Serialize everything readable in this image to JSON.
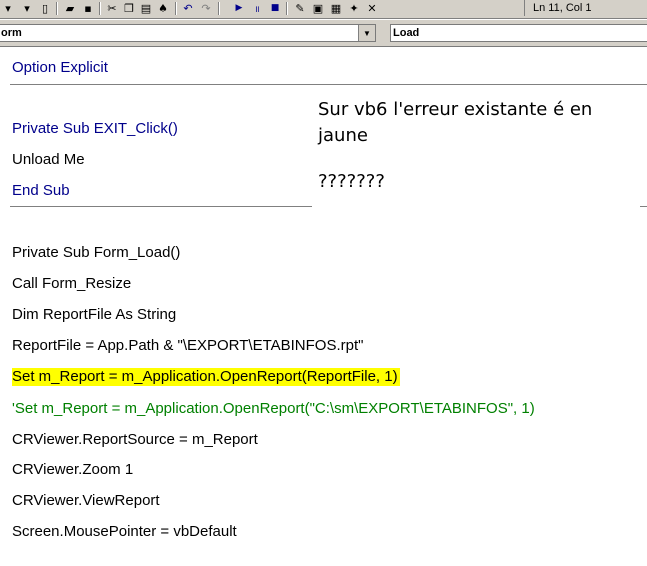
{
  "toolbar": {
    "status": "Ln 11, Col 1",
    "buttons": [
      {
        "name": "insert-dropdown-icon",
        "glyph": "▾"
      },
      {
        "name": "indent-dropdown-icon",
        "glyph": "▾"
      },
      {
        "name": "delete-icon",
        "glyph": "▯"
      },
      {
        "name": "open-icon",
        "glyph": "▰"
      },
      {
        "name": "save-icon",
        "glyph": "▪"
      },
      {
        "name": "cut-icon",
        "glyph": "✂"
      },
      {
        "name": "copy-icon",
        "glyph": "❐"
      },
      {
        "name": "paste-icon",
        "glyph": "▤"
      },
      {
        "name": "find-icon",
        "glyph": "♠"
      },
      {
        "name": "undo-icon",
        "glyph": "↶"
      },
      {
        "name": "redo-icon",
        "glyph": "↷"
      },
      {
        "name": "run-icon",
        "glyph": "▶"
      },
      {
        "name": "pause-icon",
        "glyph": "⏸"
      },
      {
        "name": "stop-icon",
        "glyph": "■"
      },
      {
        "name": "design-mode-icon",
        "glyph": "✎"
      },
      {
        "name": "project-explorer-icon",
        "glyph": "▣"
      },
      {
        "name": "properties-icon",
        "glyph": "▦"
      },
      {
        "name": "object-browser-icon",
        "glyph": "✦"
      },
      {
        "name": "toolbox-icon",
        "glyph": "✕"
      }
    ]
  },
  "combos": {
    "object": "orm",
    "procedure": "Load"
  },
  "code": {
    "line1": "Option Explicit",
    "line2": "Private Sub EXIT_Click()",
    "line3": "Unload Me",
    "line4": "End Sub",
    "line5": "Private Sub Form_Load()",
    "line6": "Call Form_Resize",
    "line7": "Dim ReportFile As String",
    "line8": "ReportFile = App.Path & \"\\EXPORT\\ETABINFOS.rpt\"",
    "line9": "Set m_Report = m_Application.OpenReport(ReportFile, 1)",
    "line10": "'Set m_Report = m_Application.OpenReport(\"C:\\sm\\EXPORT\\ETABINFOS\", 1)",
    "line11": "CRViewer.ReportSource = m_Report",
    "line12": "CRViewer.Zoom 1",
    "line13": "CRViewer.ViewReport",
    "line14": "Screen.MousePointer = vbDefault"
  },
  "note": {
    "line1": "Sur vb6 l'erreur existante é en",
    "line2": "jaune",
    "line3": "???????"
  },
  "colors": {
    "keyword": "#00008b",
    "comment": "#008000",
    "error_highlight": "#ffff00",
    "chrome": "#d4d0c8"
  }
}
